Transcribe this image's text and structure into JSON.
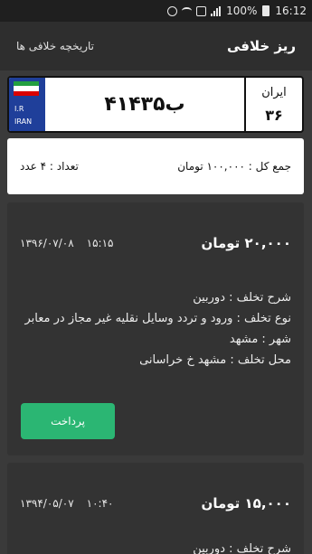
{
  "status_bar": {
    "battery": "100%",
    "time": "16:12"
  },
  "app_bar": {
    "title": "ریز خلافی",
    "history_link": "تاریخچه خلافی ها"
  },
  "plate": {
    "flag_text": "I.R",
    "country_text": "IRAN",
    "number": "۴۱ب۴۳۵",
    "region_label": "ایران",
    "region_code": "۳۶"
  },
  "summary": {
    "total": "جمع کل : ۱۰۰,۰۰۰ تومان",
    "count": "تعداد : ۴ عدد"
  },
  "violations": [
    {
      "amount": "۲۰,۰۰۰ تومان",
      "time": "۱۵:۱۵",
      "date": "۱۳۹۶/۰۷/۰۸",
      "description": "شرح تخلف : دوربین",
      "type": "نوع تخلف : ورود و تردد وسایل نقلیه غیر مجاز در معابر",
      "city": "شهر : مشهد",
      "location": "محل تخلف : مشهد خ خراسانی",
      "pay_label": "پرداخت"
    },
    {
      "amount": "۱۵,۰۰۰ تومان",
      "time": "۱۰:۴۰",
      "date": "۱۳۹۴/۰۵/۰۷",
      "description": "شرح تخلف : دوربین"
    }
  ],
  "colors": {
    "accent": "#2bb673",
    "background": "#3a3a3a",
    "flag_blue": "#1f3f9a"
  }
}
